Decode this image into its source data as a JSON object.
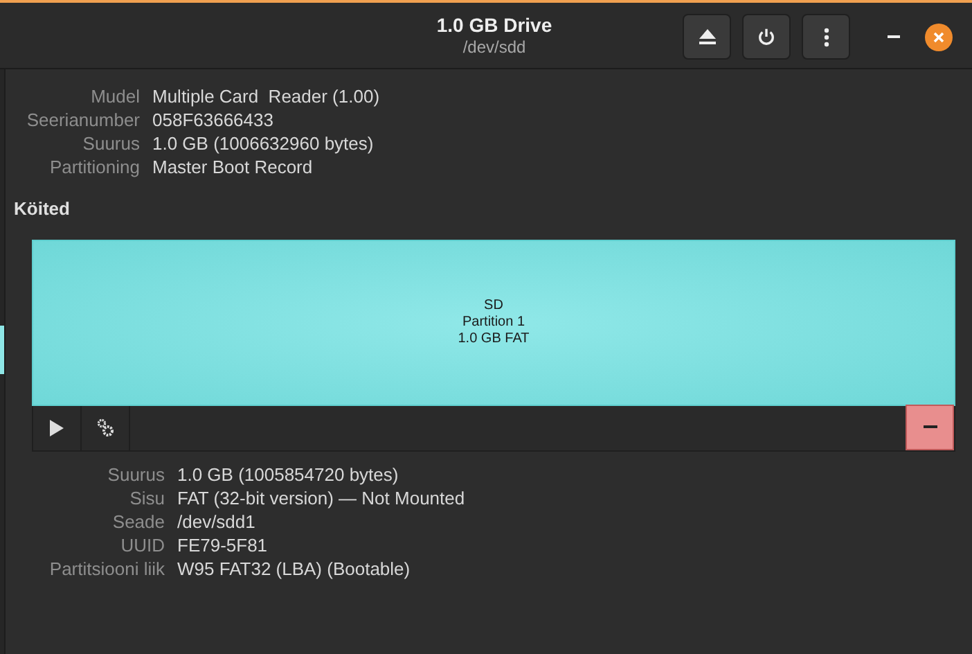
{
  "window": {
    "title": "1.0 GB Drive",
    "subtitle": "/dev/sdd"
  },
  "drive_info": [
    {
      "label": "Mudel",
      "value": "Multiple Card  Reader (1.00)"
    },
    {
      "label": "Seerianumber",
      "value": "058F63666433"
    },
    {
      "label": "Suurus",
      "value": "1.0 GB (1006632960 bytes)"
    },
    {
      "label": "Partitioning",
      "value": "Master Boot Record"
    }
  ],
  "volumes": {
    "heading": "Köited",
    "partitions": [
      {
        "lines": [
          "SD",
          "Partition 1",
          "1.0 GB FAT"
        ],
        "selected": true
      }
    ]
  },
  "partition_info": [
    {
      "label": "Suurus",
      "value": "1.0 GB (1005854720 bytes)"
    },
    {
      "label": "Sisu",
      "value": "FAT (32-bit version) — Not Mounted"
    },
    {
      "label": "Seade",
      "value": "/dev/sdd1"
    },
    {
      "label": "UUID",
      "value": "FE79-5F81"
    },
    {
      "label": "Partitsiooni liik",
      "value": "W95 FAT32 (LBA) (Bootable)"
    }
  ]
}
